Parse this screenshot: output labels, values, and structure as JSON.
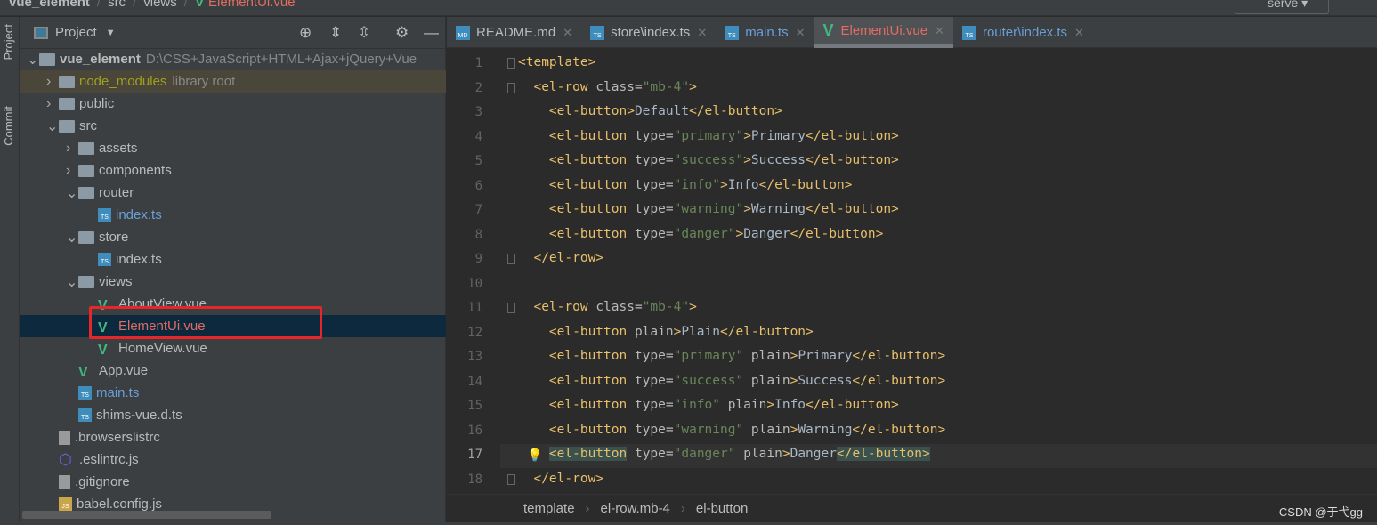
{
  "breadcrumb": [
    "vue_element",
    "src",
    "views",
    "ElementUi.vue"
  ],
  "run_config": "serve",
  "tool_strip": {
    "project": "Project",
    "commit": "Commit"
  },
  "project_panel": {
    "title": "Project",
    "tree": [
      {
        "label": "vue_element",
        "extra": "D:\\CSS+JavaScript+HTML+Ajax+jQuery+Vue",
        "type": "folder",
        "depth": 0,
        "chev": "open",
        "bold": true
      },
      {
        "label": "node_modules",
        "extra": "library root",
        "type": "folder",
        "depth": 1,
        "chev": "closed",
        "lib": true
      },
      {
        "label": "public",
        "type": "folder",
        "depth": 1,
        "chev": "closed"
      },
      {
        "label": "src",
        "type": "folder",
        "depth": 1,
        "chev": "open"
      },
      {
        "label": "assets",
        "type": "folder",
        "depth": 2,
        "chev": "closed"
      },
      {
        "label": "components",
        "type": "folder",
        "depth": 2,
        "chev": "closed"
      },
      {
        "label": "router",
        "type": "folder",
        "depth": 2,
        "chev": "open"
      },
      {
        "label": "index.ts",
        "type": "ts",
        "depth": 3,
        "blue": true
      },
      {
        "label": "store",
        "type": "folder",
        "depth": 2,
        "chev": "open"
      },
      {
        "label": "index.ts",
        "type": "ts",
        "depth": 3
      },
      {
        "label": "views",
        "type": "folder",
        "depth": 2,
        "chev": "open"
      },
      {
        "label": "AboutView.vue",
        "type": "vue",
        "depth": 3
      },
      {
        "label": "ElementUi.vue",
        "type": "vue",
        "depth": 3,
        "selected": true,
        "red": true
      },
      {
        "label": "HomeView.vue",
        "type": "vue",
        "depth": 3
      },
      {
        "label": "App.vue",
        "type": "vue",
        "depth": 2
      },
      {
        "label": "main.ts",
        "type": "ts",
        "depth": 2,
        "blue": true
      },
      {
        "label": "shims-vue.d.ts",
        "type": "ts",
        "depth": 2
      },
      {
        "label": ".browserslistrc",
        "type": "gen",
        "depth": 1
      },
      {
        "label": ".eslintrc.js",
        "type": "eslint",
        "depth": 1
      },
      {
        "label": ".gitignore",
        "type": "gen",
        "depth": 1
      },
      {
        "label": "babel.config.js",
        "type": "js",
        "depth": 1
      }
    ]
  },
  "tabs": [
    {
      "label": "README.md",
      "icon": "MD"
    },
    {
      "label": "store\\index.ts",
      "icon": "TS"
    },
    {
      "label": "main.ts",
      "icon": "TS",
      "blue": true
    },
    {
      "label": "ElementUi.vue",
      "icon": "vue",
      "active": true
    },
    {
      "label": "router\\index.ts",
      "icon": "TS",
      "blue": true
    }
  ],
  "code": [
    [
      [
        "tg",
        "<template>"
      ]
    ],
    [
      [
        "tg",
        "  <el-row "
      ],
      [
        "at",
        "class="
      ],
      [
        "st",
        "\"mb-4\""
      ],
      [
        "tg",
        ">"
      ]
    ],
    [
      [
        "tg",
        "    <el-button>"
      ],
      [
        "tx",
        "Default"
      ],
      [
        "tg",
        "</el-button>"
      ]
    ],
    [
      [
        "tg",
        "    <el-button "
      ],
      [
        "at",
        "type="
      ],
      [
        "st",
        "\"primary\""
      ],
      [
        "tg",
        ">"
      ],
      [
        "tx",
        "Primary"
      ],
      [
        "tg",
        "</el-button>"
      ]
    ],
    [
      [
        "tg",
        "    <el-button "
      ],
      [
        "at",
        "type="
      ],
      [
        "st",
        "\"success\""
      ],
      [
        "tg",
        ">"
      ],
      [
        "tx",
        "Success"
      ],
      [
        "tg",
        "</el-button>"
      ]
    ],
    [
      [
        "tg",
        "    <el-button "
      ],
      [
        "at",
        "type="
      ],
      [
        "st",
        "\"info\""
      ],
      [
        "tg",
        ">"
      ],
      [
        "tx",
        "Info"
      ],
      [
        "tg",
        "</el-button>"
      ]
    ],
    [
      [
        "tg",
        "    <el-button "
      ],
      [
        "at",
        "type="
      ],
      [
        "st",
        "\"warning\""
      ],
      [
        "tg",
        ">"
      ],
      [
        "tx",
        "Warning"
      ],
      [
        "tg",
        "</el-button>"
      ]
    ],
    [
      [
        "tg",
        "    <el-button "
      ],
      [
        "at",
        "type="
      ],
      [
        "st",
        "\"danger\""
      ],
      [
        "tg",
        ">"
      ],
      [
        "tx",
        "Danger"
      ],
      [
        "tg",
        "</el-button>"
      ]
    ],
    [
      [
        "tg",
        "  </el-row>"
      ]
    ],
    [],
    [
      [
        "tg",
        "  <el-row "
      ],
      [
        "at",
        "class="
      ],
      [
        "st",
        "\"mb-4\""
      ],
      [
        "tg",
        ">"
      ]
    ],
    [
      [
        "tg",
        "    <el-button "
      ],
      [
        "at",
        "plain"
      ],
      [
        "tg",
        ">"
      ],
      [
        "tx",
        "Plain"
      ],
      [
        "tg",
        "</el-button>"
      ]
    ],
    [
      [
        "tg",
        "    <el-button "
      ],
      [
        "at",
        "type="
      ],
      [
        "st",
        "\"primary\" "
      ],
      [
        "at",
        "plain"
      ],
      [
        "tg",
        ">"
      ],
      [
        "tx",
        "Primary"
      ],
      [
        "tg",
        "</el-button>"
      ]
    ],
    [
      [
        "tg",
        "    <el-button "
      ],
      [
        "at",
        "type="
      ],
      [
        "st",
        "\"success\" "
      ],
      [
        "at",
        "plain"
      ],
      [
        "tg",
        ">"
      ],
      [
        "tx",
        "Success"
      ],
      [
        "tg",
        "</el-button>"
      ]
    ],
    [
      [
        "tg",
        "    <el-button "
      ],
      [
        "at",
        "type="
      ],
      [
        "st",
        "\"info\" "
      ],
      [
        "at",
        "plain"
      ],
      [
        "tg",
        ">"
      ],
      [
        "tx",
        "Info"
      ],
      [
        "tg",
        "</el-button>"
      ]
    ],
    [
      [
        "tg",
        "    <el-button "
      ],
      [
        "at",
        "type="
      ],
      [
        "st",
        "\"warning\" "
      ],
      [
        "at",
        "plain"
      ],
      [
        "tg",
        ">"
      ],
      [
        "tx",
        "Warning"
      ],
      [
        "tg",
        "</el-button>"
      ]
    ],
    [
      [
        "tg",
        "    "
      ],
      [
        "tg mt",
        "<el-button"
      ],
      [
        "at",
        " type="
      ],
      [
        "st",
        "\"danger\" "
      ],
      [
        "at",
        "plain"
      ],
      [
        "tg",
        ">"
      ],
      [
        "tx",
        "Danger"
      ],
      [
        "tg mt",
        "</el-button>"
      ]
    ],
    [
      [
        "tg",
        "  </el-row>"
      ]
    ]
  ],
  "current_line": 17,
  "status_path": [
    "template",
    "el-row.mb-4",
    "el-button"
  ],
  "watermark": "CSDN @于弋gg",
  "colors": {
    "tag": "#e8bf6a",
    "attr": "#bababa",
    "string": "#6a8759",
    "text": "#a9b7c6",
    "active_file": "#e06c62",
    "selection": "#0d293e",
    "highlight_box": "#e8262a"
  }
}
